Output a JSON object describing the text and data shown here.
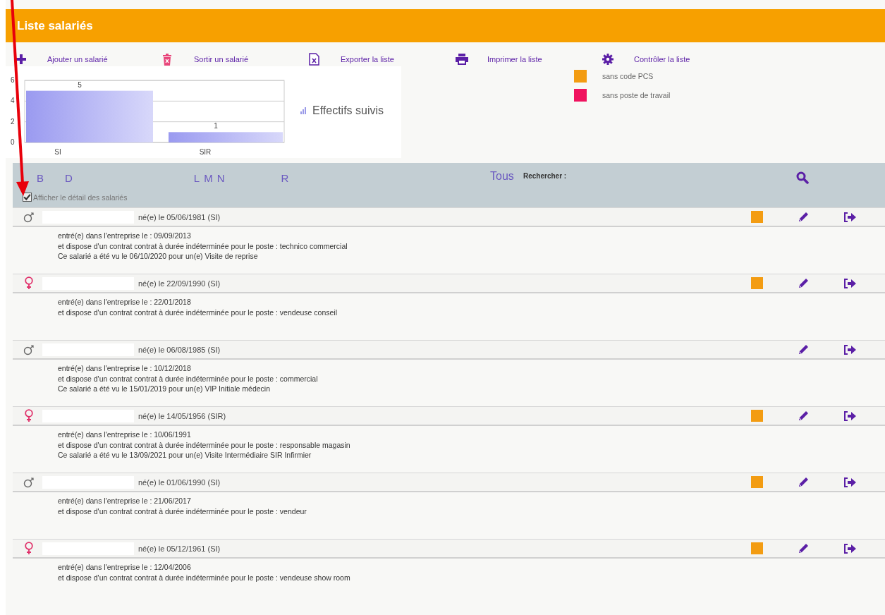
{
  "header": {
    "title": "Liste salariés"
  },
  "toolbar": [
    {
      "kind": "add",
      "label": "Ajouter un salarié"
    },
    {
      "kind": "remove",
      "label": "Sortir un salarié"
    },
    {
      "kind": "export",
      "label": "Exporter la liste"
    },
    {
      "kind": "print",
      "label": "Imprimer la liste"
    },
    {
      "kind": "check",
      "label": "Contrôler la liste"
    }
  ],
  "chart": {
    "legend_label": "Effectifs suivis",
    "chart_data": {
      "type": "bar",
      "categories": [
        "SI",
        "SIR"
      ],
      "values": [
        5,
        1
      ],
      "ylim": [
        0,
        6
      ],
      "yticks": [
        0,
        2,
        4,
        6
      ],
      "data_labels": true
    }
  },
  "legend": [
    {
      "label": "sans code PCS",
      "color": "#f39c12"
    },
    {
      "label": "sans poste de travail",
      "color": "#f0135f"
    }
  ],
  "filter": {
    "letters": [
      "B",
      "D",
      "L",
      "M",
      "N",
      "R"
    ],
    "all_label": "Tous",
    "search_label": "Rechercher :",
    "detail_toggle": {
      "label": "Afficher le détail des salariés",
      "checked": true
    }
  },
  "employees": [
    {
      "kind": "male",
      "birth": "né(e) le 05/06/1981 (SI)",
      "missing_pcs": true,
      "details": [
        "entré(e) dans l'entreprise le : 09/09/2013",
        "et dispose d'un contrat contrat à durée indéterminée pour le poste : technico commercial",
        "Ce salarié a été vu le 06/10/2020 pour un(e) Visite de reprise"
      ]
    },
    {
      "kind": "female",
      "birth": "né(e) le 22/09/1990 (SI)",
      "missing_pcs": true,
      "details": [
        "entré(e) dans l'entreprise le : 22/01/2018",
        "et dispose d'un contrat contrat à durée indéterminée pour le poste : vendeuse conseil"
      ]
    },
    {
      "kind": "male",
      "birth": "né(e) le 06/08/1985 (SI)",
      "missing_pcs": false,
      "details": [
        "entré(e) dans l'entreprise le : 10/12/2018",
        "et dispose d'un contrat contrat à durée indéterminée pour le poste : commercial",
        "Ce salarié a été vu le 15/01/2019 pour un(e) VIP Initiale médecin"
      ]
    },
    {
      "kind": "female",
      "birth": "né(e) le 14/05/1956 (SIR)",
      "missing_pcs": true,
      "details": [
        "entré(e) dans l'entreprise le : 10/06/1991",
        "et dispose d'un contrat contrat à durée indéterminée pour le poste : responsable magasin",
        "Ce salarié a été vu le 13/09/2021 pour un(e) Visite Intermédiaire SIR Infirmier"
      ]
    },
    {
      "kind": "male",
      "birth": "né(e) le 01/06/1990 (SI)",
      "missing_pcs": true,
      "details": [
        "entré(e) dans l'entreprise le : 21/06/2017",
        "et dispose d'un contrat contrat à durée indéterminée pour le poste : vendeur"
      ]
    },
    {
      "kind": "female",
      "birth": "né(e) le 05/12/1961 (SI)",
      "missing_pcs": true,
      "details": [
        "entré(e) dans l'entreprise le : 12/04/2006",
        "et dispose d'un contrat contrat à durée indéterminée pour le poste : vendeuse show room"
      ]
    }
  ],
  "annotation": {
    "kind": "arrow"
  }
}
